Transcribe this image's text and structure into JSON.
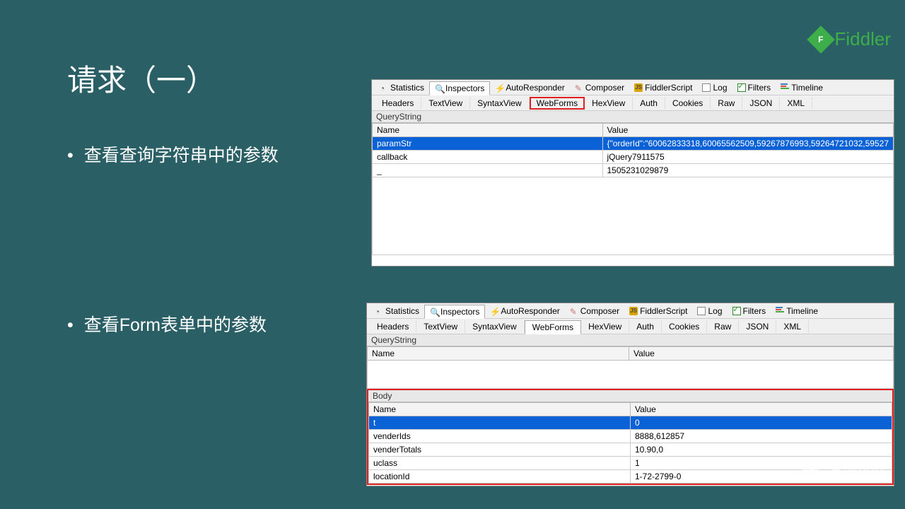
{
  "slide": {
    "title": "请求（一）",
    "bullet1": "查看查询字符串中的参数",
    "bullet2": "查看Form表单中的参数"
  },
  "brand": {
    "name": "Fiddler",
    "letter": "F"
  },
  "main_tabs": [
    "Statistics",
    "Inspectors",
    "AutoResponder",
    "Composer",
    "FiddlerScript",
    "Log",
    "Filters",
    "Timeline"
  ],
  "main_tabs_active": "Inspectors",
  "sub_tabs": [
    "Headers",
    "TextView",
    "SyntaxView",
    "WebForms",
    "HexView",
    "Auth",
    "Cookies",
    "Raw",
    "JSON",
    "XML"
  ],
  "panel1": {
    "highlighted_tab": "WebForms",
    "section1_label": "QueryString",
    "columns": [
      "Name",
      "Value"
    ],
    "rows": [
      {
        "name": "paramStr",
        "value": "{\"orderId\":\"60062833318,60065562509,59267876993,59264721032,59527",
        "selected": true
      },
      {
        "name": "callback",
        "value": "jQuery7911575",
        "selected": false
      },
      {
        "name": "_",
        "value": "1505231029879",
        "selected": false
      }
    ]
  },
  "panel2": {
    "highlighted_tab": "WebForms",
    "section1_label": "QueryString",
    "section2_label": "Body",
    "columns": [
      "Name",
      "Value"
    ],
    "qs_rows": [],
    "body_rows": [
      {
        "name": "t",
        "value": "0",
        "selected": true
      },
      {
        "name": "venderIds",
        "value": "8888,612857",
        "selected": false
      },
      {
        "name": "venderTotals",
        "value": "10.90,0",
        "selected": false
      },
      {
        "name": "uclass",
        "value": "1",
        "selected": false
      },
      {
        "name": "locationId",
        "value": "1-72-2799-0",
        "selected": false
      }
    ]
  },
  "watermark": "发现bug"
}
